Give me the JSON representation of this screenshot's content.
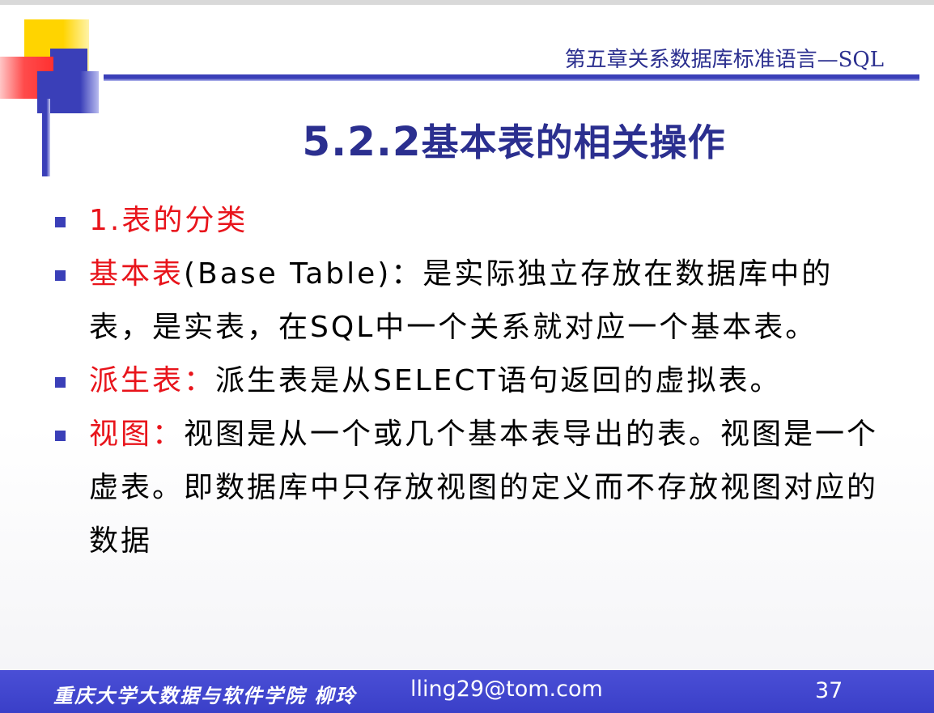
{
  "header": {
    "chapter": "第五章关系数据库标准语言—SQL"
  },
  "title": {
    "number": "5.2.2",
    "text": "基本表的相关操作"
  },
  "bullets": [
    {
      "term": "1.表的分类",
      "body": ""
    },
    {
      "term": "基本表",
      "body": "(Base Table)：是实际独立存放在数据库中的表，是实表，在SQL中一个关系就对应一个基本表。"
    },
    {
      "term": "派生表：",
      "body": "派生表是从SELECT语句返回的虚拟表。"
    },
    {
      "term": "视图：",
      "body": "视图是从一个或几个基本表导出的表。视图是一个虚表。即数据库中只存放视图的定义而不存放视图对应的数据"
    }
  ],
  "footer": {
    "org": "重庆大学大数据与软件学院  柳玲",
    "email": "lling29@tom.com",
    "page": "37"
  },
  "colors": {
    "accent_blue": "#3a3fb8",
    "title_blue": "#2b2f8f",
    "term_red": "#e8141b",
    "accent_yellow": "#ffd400"
  }
}
